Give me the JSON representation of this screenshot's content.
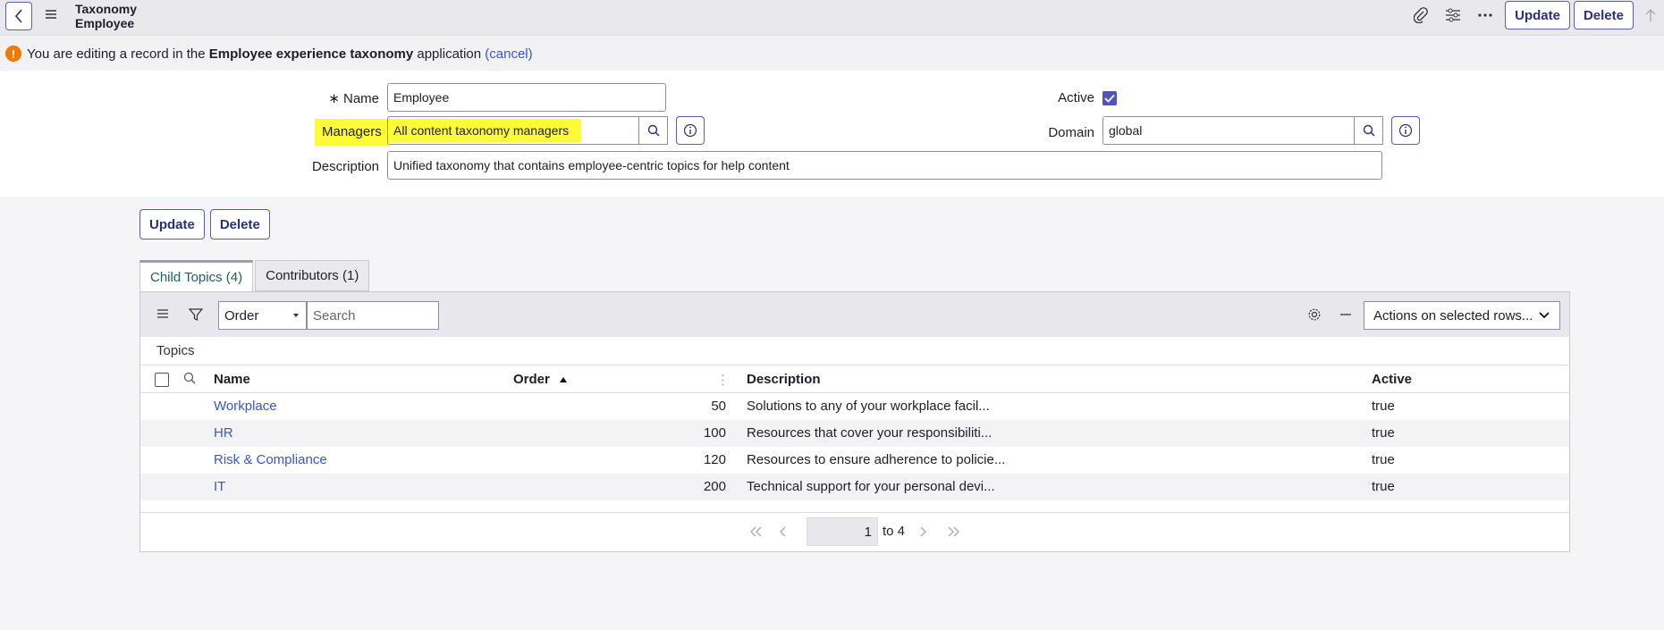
{
  "header": {
    "title_line1": "Taxonomy",
    "title_line2": "Employee",
    "update_label": "Update",
    "delete_label": "Delete"
  },
  "notice": {
    "text_before": "You are editing a record in the ",
    "app_name": "Employee experience taxonomy",
    "text_after": " application ",
    "cancel_label": "(cancel)"
  },
  "form": {
    "name_label": "Name",
    "name_value": "Employee",
    "managers_label": "Managers",
    "managers_value": "All content taxonomy managers",
    "description_label": "Description",
    "description_value": "Unified taxonomy that contains employee-centric topics for help content",
    "active_label": "Active",
    "active_checked": true,
    "domain_label": "Domain",
    "domain_value": "global",
    "highlight_color": "#fdfb38"
  },
  "buttons": {
    "update_label": "Update",
    "delete_label": "Delete"
  },
  "tabs": [
    {
      "label": "Child Topics (4)",
      "active": true
    },
    {
      "label": "Contributors (1)",
      "active": false
    }
  ],
  "list": {
    "order_select": "Order",
    "search_placeholder": "Search",
    "actions_label": "Actions on selected rows...",
    "breadcrumb": "Topics",
    "columns": {
      "name": "Name",
      "order": "Order",
      "description": "Description",
      "active": "Active"
    },
    "rows": [
      {
        "name": "Workplace",
        "order": "50",
        "description": "Solutions to any of your workplace facil...",
        "active": "true"
      },
      {
        "name": "HR",
        "order": "100",
        "description": "Resources that cover your responsibiliti...",
        "active": "true"
      },
      {
        "name": "Risk & Compliance",
        "order": "120",
        "description": "Resources to ensure adherence to policie...",
        "active": "true"
      },
      {
        "name": "IT",
        "order": "200",
        "description": "Technical support for your personal devi...",
        "active": "true"
      }
    ],
    "pager": {
      "page": "1",
      "range_text": "to 4"
    }
  },
  "colors": {
    "accent": "#5a5fb0",
    "link": "#3b55c6",
    "warning": "#f07a00"
  }
}
